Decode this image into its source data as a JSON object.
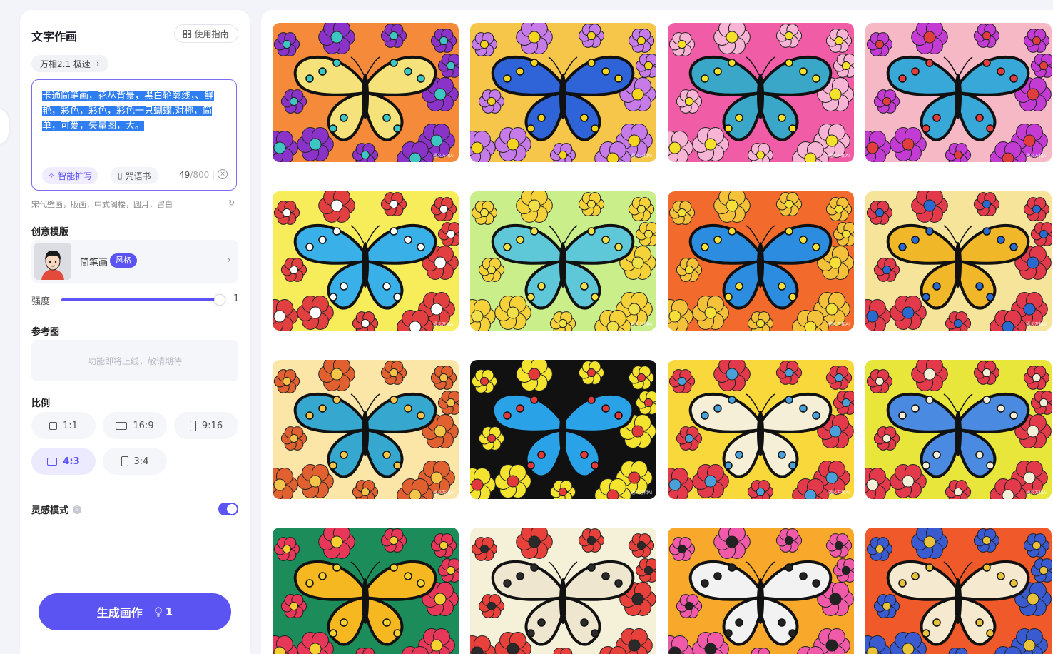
{
  "panel": {
    "title": "文字作画",
    "guide_label": "使用指南",
    "model_label": "万相2.1 极速",
    "prompt_text": "卡通简笔画，花丛背景，黑白轮廓线，、鲜艳，彩色，彩色，彩色一只蝴蝶,对称，简单，可爱，矢量图，大。",
    "expand_label": "智能扩写",
    "spellbook_label": "咒语书",
    "char_count": "49",
    "char_max": "/800",
    "suggestions": "宋代壁画，版画，中式阁楼，圆月，留白",
    "template_section": "创意模版",
    "template_name": "简笔画",
    "template_badge": "风格",
    "strength_label": "强度",
    "strength_value": "1",
    "strength_fraction": 0.94,
    "reference_section": "参考图",
    "reference_placeholder": "功能即将上线，敬请期待",
    "ratio_section": "比例",
    "ratios": [
      {
        "label": "1:1",
        "active": false
      },
      {
        "label": "16:9",
        "active": false
      },
      {
        "label": "9:16",
        "active": false
      },
      {
        "label": "4:3",
        "active": true
      },
      {
        "label": "3:4",
        "active": false
      }
    ],
    "inspiration_label": "灵感模式",
    "inspiration_on": true,
    "generate_label": "生成画作",
    "generate_cost": "1"
  },
  "gallery": {
    "watermark": "通义万相AI",
    "tiles": [
      {
        "bg": "#f58a3b",
        "flower": "#8b33c9",
        "wing": "#f5e27a",
        "spot": "#3ec6c2"
      },
      {
        "bg": "#f6c64a",
        "flower": "#c77be8",
        "wing": "#2f63d8",
        "spot": "#f5d41e"
      },
      {
        "bg": "#f05ca5",
        "flower": "#f8b4d4",
        "wing": "#3aa6c8",
        "spot": "#f5e12a"
      },
      {
        "bg": "#f7b8c6",
        "flower": "#c43bd4",
        "wing": "#37a8d8",
        "spot": "#e23d3d"
      },
      {
        "bg": "#f7ec5a",
        "flower": "#e24040",
        "wing": "#3ab0e8",
        "spot": "#ffffff"
      },
      {
        "bg": "#c9ee8a",
        "flower": "#f6d23a",
        "wing": "#5ec8d8",
        "spot": "#f0e04a"
      },
      {
        "bg": "#f26b2c",
        "flower": "#f4c13a",
        "wing": "#2b8ce0",
        "spot": "#f5e03a"
      },
      {
        "bg": "#f6e49a",
        "flower": "#e23a4a",
        "wing": "#f0b828",
        "spot": "#2a6ad0"
      },
      {
        "bg": "#fbe6a8",
        "flower": "#e06030",
        "wing": "#36a8d0",
        "spot": "#f5c54a"
      },
      {
        "bg": "#111111",
        "flower": "#f4e430",
        "wing": "#2aa2e8",
        "spot": "#e23a3a"
      },
      {
        "bg": "#f8d83a",
        "flower": "#e23a4a",
        "wing": "#f5efd8",
        "spot": "#4aa0d8"
      },
      {
        "bg": "#e8e63a",
        "flower": "#e23a4a",
        "wing": "#4a8ae0",
        "spot": "#f5efd8"
      },
      {
        "bg": "#1b8c5a",
        "flower": "#e8385a",
        "wing": "#f5b820",
        "spot": "#f5d030"
      },
      {
        "bg": "#f5f0d8",
        "flower": "#e8403a",
        "wing": "#efe6d0",
        "spot": "#2a2a2a"
      },
      {
        "bg": "#f8a82a",
        "flower": "#f05aa8",
        "wing": "#f2f2f2",
        "spot": "#222222"
      },
      {
        "bg": "#f05a2a",
        "flower": "#3a5ad0",
        "wing": "#f5ead0",
        "spot": "#e8c23a"
      }
    ]
  }
}
